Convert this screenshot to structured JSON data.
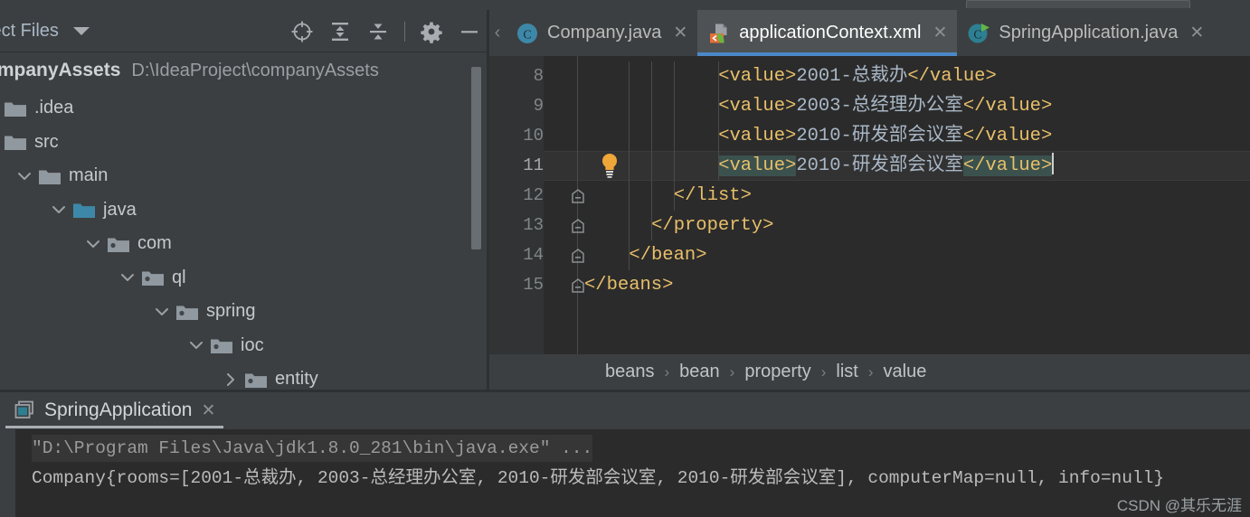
{
  "window": {
    "theme_accent": "#4a88c7",
    "editor_bg": "#2b2b2b",
    "chrome_bg": "#3c3f41"
  },
  "sidebar": {
    "title": "ject Files",
    "caret_icon": "chevron-down-icon",
    "tools": [
      {
        "name": "locate-icon",
        "label": "Select Opened File"
      },
      {
        "name": "expand-all-icon",
        "label": "Expand All"
      },
      {
        "name": "collapse-all-icon",
        "label": "Collapse All"
      },
      {
        "name": "settings-gear-icon",
        "label": "Settings"
      },
      {
        "name": "minimize-icon",
        "label": "Hide"
      }
    ],
    "project": {
      "name": "ompanyAssets",
      "path": "D:\\IdeaProject\\companyAssets"
    },
    "tree": [
      {
        "label": ".idea",
        "depth": 0,
        "arrow": "none",
        "icon": "folder-grey-icon"
      },
      {
        "label": "src",
        "depth": 0,
        "arrow": "none",
        "icon": "folder-grey-icon"
      },
      {
        "label": "main",
        "depth": 1,
        "arrow": "expanded",
        "icon": "folder-grey-icon"
      },
      {
        "label": "java",
        "depth": 2,
        "arrow": "expanded",
        "icon": "folder-source-icon"
      },
      {
        "label": "com",
        "depth": 3,
        "arrow": "expanded",
        "icon": "folder-package-icon"
      },
      {
        "label": "ql",
        "depth": 4,
        "arrow": "expanded",
        "icon": "folder-package-icon"
      },
      {
        "label": "spring",
        "depth": 5,
        "arrow": "expanded",
        "icon": "folder-package-icon"
      },
      {
        "label": "ioc",
        "depth": 6,
        "arrow": "expanded",
        "icon": "folder-package-icon"
      },
      {
        "label": "entity",
        "depth": 7,
        "arrow": "collapsed",
        "icon": "folder-package-icon"
      }
    ]
  },
  "editor": {
    "tabs": [
      {
        "label": "Company.java",
        "icon": "java-class-icon",
        "active": false,
        "close_icon": "close-icon"
      },
      {
        "label": "applicationContext.xml",
        "icon": "spring-xml-icon",
        "active": true,
        "close_icon": "close-icon"
      },
      {
        "label": "SpringApplication.java",
        "icon": "java-runnable-icon",
        "active": false,
        "close_icon": "close-icon"
      }
    ],
    "prev_tab_icon": "chevron-left-icon",
    "lines": [
      {
        "number": "8",
        "indent": 12,
        "fold": "none",
        "bulb": false,
        "current": false,
        "segments": [
          {
            "text": "<value>",
            "style": "tag"
          },
          {
            "text": "2001-总裁办",
            "style": "text"
          },
          {
            "text": "</value>",
            "style": "tag"
          }
        ]
      },
      {
        "number": "9",
        "indent": 12,
        "fold": "none",
        "bulb": false,
        "current": false,
        "segments": [
          {
            "text": "<value>",
            "style": "tag"
          },
          {
            "text": "2003-总经理办公室",
            "style": "text"
          },
          {
            "text": "</value>",
            "style": "tag"
          }
        ]
      },
      {
        "number": "10",
        "indent": 12,
        "fold": "none",
        "bulb": false,
        "current": false,
        "segments": [
          {
            "text": "<value>",
            "style": "tag"
          },
          {
            "text": "2010-研发部会议室",
            "style": "text"
          },
          {
            "text": "</value>",
            "style": "tag"
          }
        ]
      },
      {
        "number": "11",
        "indent": 12,
        "fold": "none",
        "bulb": true,
        "current": true,
        "segments": [
          {
            "text": "<value>",
            "style": "tag",
            "highlight": true
          },
          {
            "text": "2010-研发部会议室",
            "style": "text"
          },
          {
            "text": "</value>",
            "style": "tag",
            "highlight": true
          }
        ]
      },
      {
        "number": "12",
        "indent": 8,
        "fold": "minus",
        "bulb": false,
        "current": false,
        "segments": [
          {
            "text": "</list>",
            "style": "tag"
          }
        ]
      },
      {
        "number": "13",
        "indent": 6,
        "fold": "minus",
        "bulb": false,
        "current": false,
        "segments": [
          {
            "text": "</property>",
            "style": "tag"
          }
        ]
      },
      {
        "number": "14",
        "indent": 4,
        "fold": "minus",
        "bulb": false,
        "current": false,
        "segments": [
          {
            "text": "</bean>",
            "style": "tag"
          }
        ]
      },
      {
        "number": "15",
        "indent": 0,
        "fold": "minus",
        "bulb": false,
        "current": false,
        "segments": [
          {
            "text": "</beans>",
            "style": "tag"
          }
        ]
      }
    ],
    "breadcrumbs": [
      "beans",
      "bean",
      "property",
      "list",
      "value"
    ],
    "breadcrumb_separator": "›"
  },
  "run_window": {
    "tab": {
      "label": "SpringApplication",
      "icon": "console-icon",
      "close_icon": "close-icon"
    },
    "console": [
      {
        "text": "\"D:\\Program Files\\Java\\jdk1.8.0_281\\bin\\java.exe\" ...",
        "kind": "cmd"
      },
      {
        "text": "Company{rooms=[2001-总裁办, 2003-总经理办公室, 2010-研发部会议室, 2010-研发部会议室], computerMap=null, info=null}",
        "kind": "out"
      }
    ],
    "watermark": "CSDN @其乐无涯"
  }
}
